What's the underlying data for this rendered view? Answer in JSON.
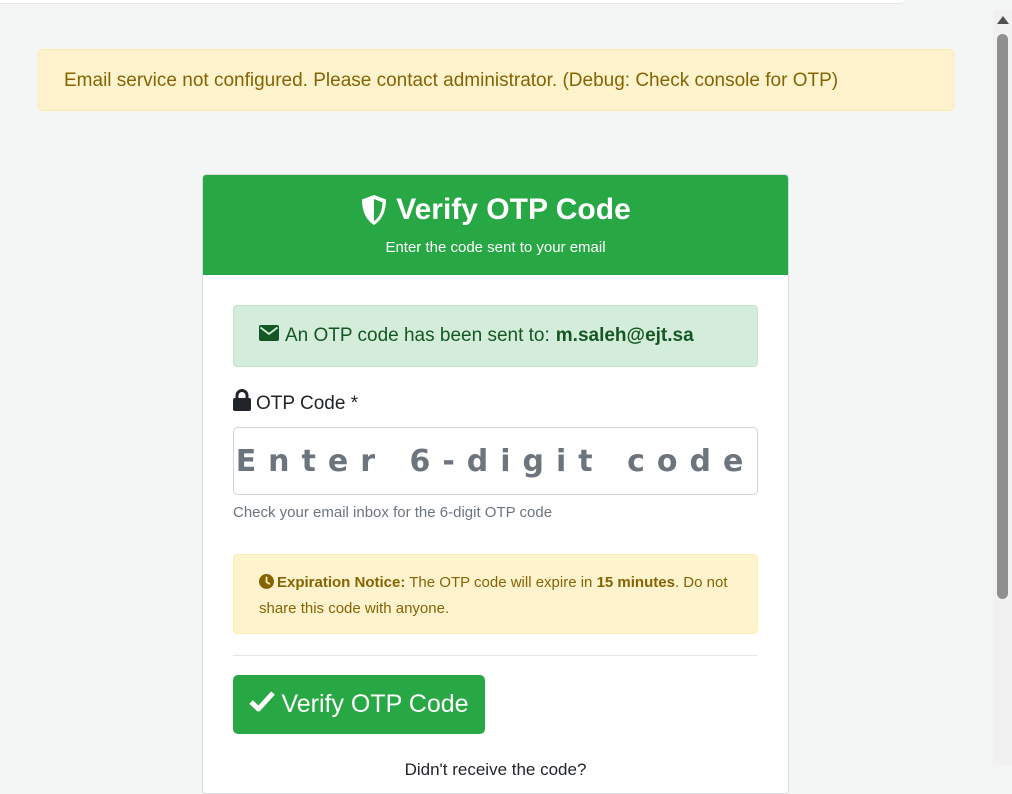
{
  "top_alert": {
    "text": "Email service not configured. Please contact administrator. (Debug: Check console for OTP)"
  },
  "card": {
    "header": {
      "icon": "shield-icon",
      "title": "Verify OTP Code",
      "subtitle": "Enter the code sent to your email"
    },
    "sent_alert": {
      "icon": "envelope-icon",
      "prefix": "An OTP code has been sent to:",
      "email": "m.saleh@ejt.sa"
    },
    "otp_field": {
      "icon": "lock-icon",
      "label": "OTP Code *",
      "placeholder": "Enter 6-digit code",
      "value": "",
      "help": "Check your email inbox for the 6-digit OTP code"
    },
    "expiration": {
      "icon": "clock-icon",
      "title": "Expiration Notice:",
      "text_before": "The OTP code will expire in",
      "duration": "15 minutes",
      "text_after": ". Do not share this code with anyone."
    },
    "verify_button": {
      "icon": "check-icon",
      "label": "Verify OTP Code"
    },
    "resend_prompt": "Didn't receive the code?"
  },
  "colors": {
    "primary": "#28a745",
    "warning_bg": "#fff3cd",
    "warning_text": "#856404",
    "success_bg": "#d4edda",
    "success_text": "#155724"
  }
}
